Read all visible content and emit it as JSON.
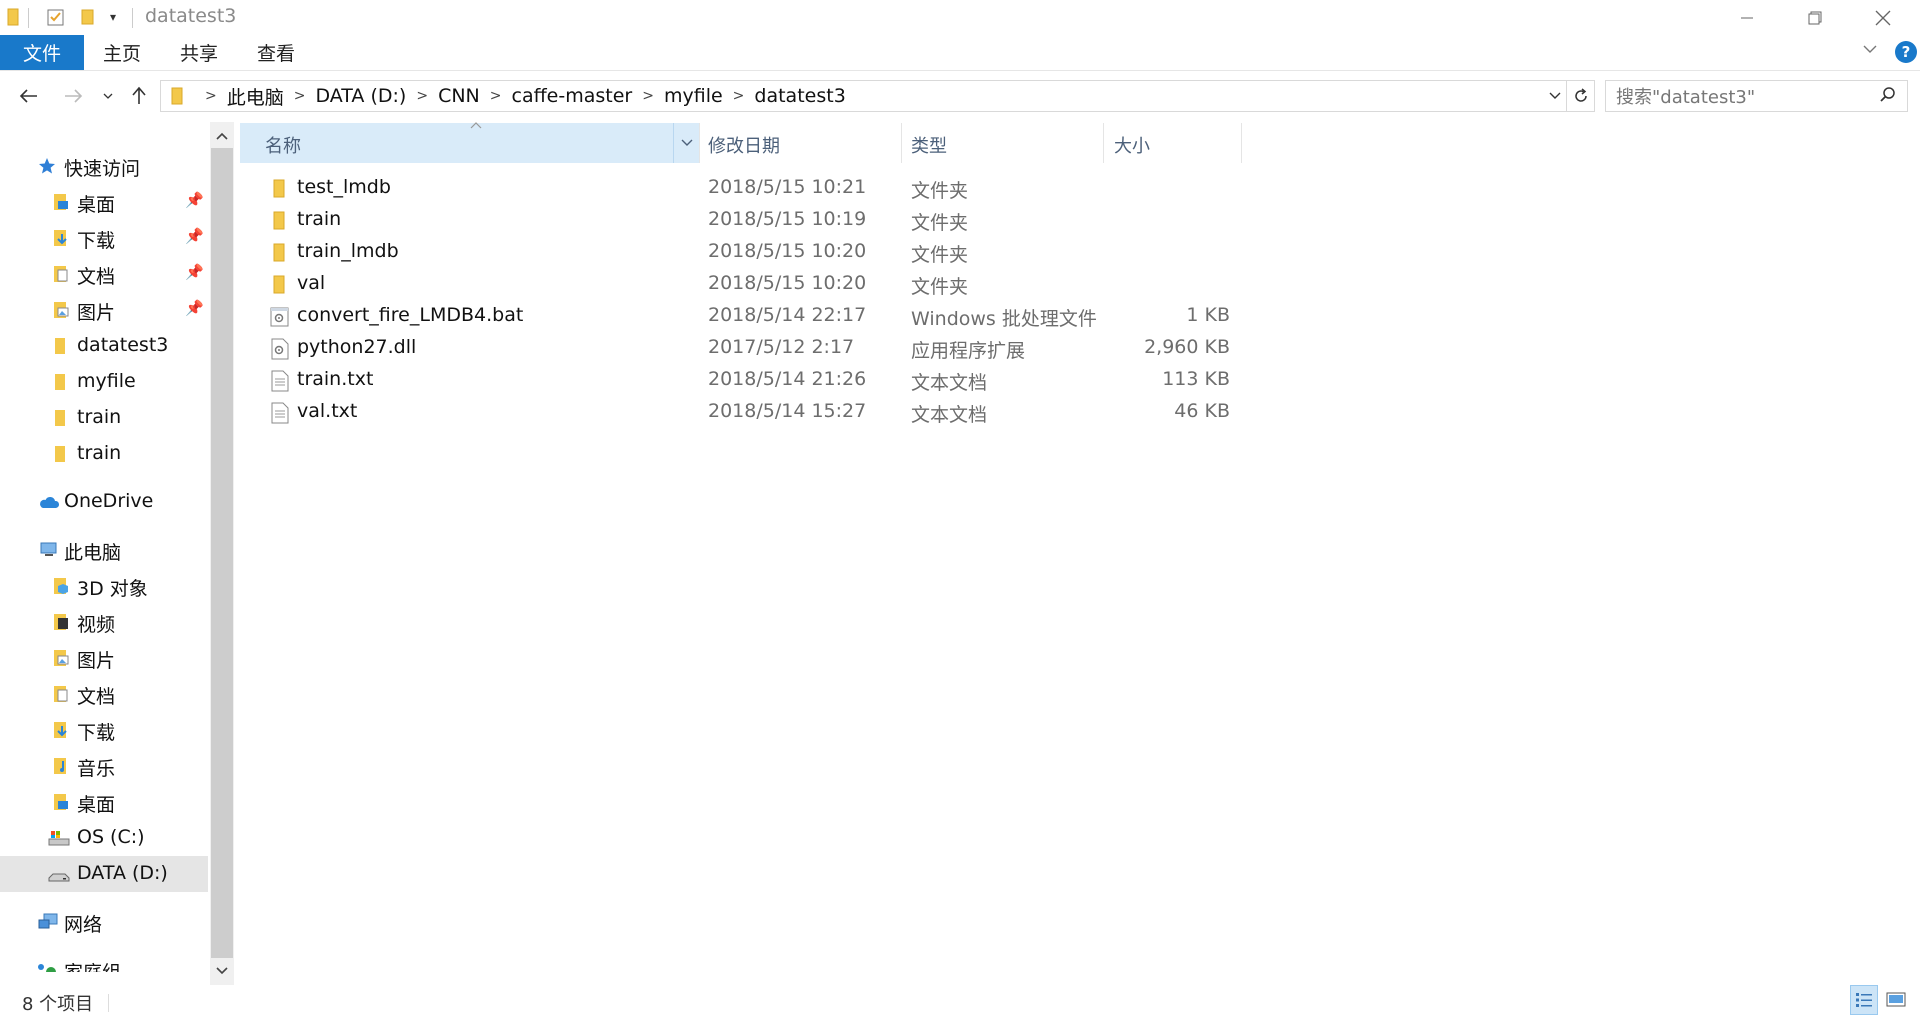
{
  "window": {
    "title": "datatest3"
  },
  "ribbon": {
    "tabs": [
      {
        "label": "文件"
      },
      {
        "label": "主页"
      },
      {
        "label": "共享"
      },
      {
        "label": "查看"
      }
    ],
    "help_label": "?"
  },
  "address": {
    "crumbs": [
      "此电脑",
      "DATA (D:)",
      "CNN",
      "caffe-master",
      "myfile",
      "datatest3"
    ]
  },
  "search": {
    "placeholder": "搜索\"datatest3\""
  },
  "nav": {
    "quick_access": "快速访问",
    "quick_items": [
      {
        "label": "桌面",
        "icon": "desktop-folder-icon",
        "pinned": true
      },
      {
        "label": "下载",
        "icon": "downloads-folder-icon",
        "pinned": true
      },
      {
        "label": "文档",
        "icon": "documents-folder-icon",
        "pinned": true
      },
      {
        "label": "图片",
        "icon": "pictures-folder-icon",
        "pinned": true
      },
      {
        "label": "datatest3",
        "icon": "folder-icon",
        "pinned": false
      },
      {
        "label": "myfile",
        "icon": "folder-icon",
        "pinned": false
      },
      {
        "label": "train",
        "icon": "folder-icon",
        "pinned": false
      },
      {
        "label": "train",
        "icon": "folder-icon",
        "pinned": false
      }
    ],
    "onedrive": "OneDrive",
    "this_pc": "此电脑",
    "pc_items": [
      {
        "label": "3D 对象",
        "icon": "3d-objects-folder-icon"
      },
      {
        "label": "视频",
        "icon": "videos-folder-icon"
      },
      {
        "label": "图片",
        "icon": "pictures-folder-icon"
      },
      {
        "label": "文档",
        "icon": "documents-folder-icon"
      },
      {
        "label": "下载",
        "icon": "downloads-folder-icon"
      },
      {
        "label": "音乐",
        "icon": "music-folder-icon"
      },
      {
        "label": "桌面",
        "icon": "desktop-folder-icon"
      },
      {
        "label": "OS (C:)",
        "icon": "system-drive-icon"
      },
      {
        "label": "DATA (D:)",
        "icon": "drive-icon"
      }
    ],
    "network": "网络",
    "homegroup": "家庭组"
  },
  "columns": {
    "name": "名称",
    "date": "修改日期",
    "type": "类型",
    "size": "大小"
  },
  "files": [
    {
      "name": "test_lmdb",
      "date": "2018/5/15 10:21",
      "type": "文件夹",
      "size": "",
      "kind": "folder"
    },
    {
      "name": "train",
      "date": "2018/5/15 10:19",
      "type": "文件夹",
      "size": "",
      "kind": "folder"
    },
    {
      "name": "train_lmdb",
      "date": "2018/5/15 10:20",
      "type": "文件夹",
      "size": "",
      "kind": "folder"
    },
    {
      "name": "val",
      "date": "2018/5/15 10:20",
      "type": "文件夹",
      "size": "",
      "kind": "folder"
    },
    {
      "name": "convert_fire_LMDB4.bat",
      "date": "2018/5/14 22:17",
      "type": "Windows 批处理文件",
      "size": "1 KB",
      "kind": "bat"
    },
    {
      "name": "python27.dll",
      "date": "2017/5/12 2:17",
      "type": "应用程序扩展",
      "size": "2,960 KB",
      "kind": "dll"
    },
    {
      "name": "train.txt",
      "date": "2018/5/14 21:26",
      "type": "文本文档",
      "size": "113 KB",
      "kind": "txt"
    },
    {
      "name": "val.txt",
      "date": "2018/5/14 15:27",
      "type": "文本文档",
      "size": "46 KB",
      "kind": "txt"
    }
  ],
  "status": {
    "count": "8 个项目"
  },
  "colors": {
    "accent": "#1979ca",
    "folder": "#f3c84a",
    "selected_header": "#d9ebf9"
  }
}
